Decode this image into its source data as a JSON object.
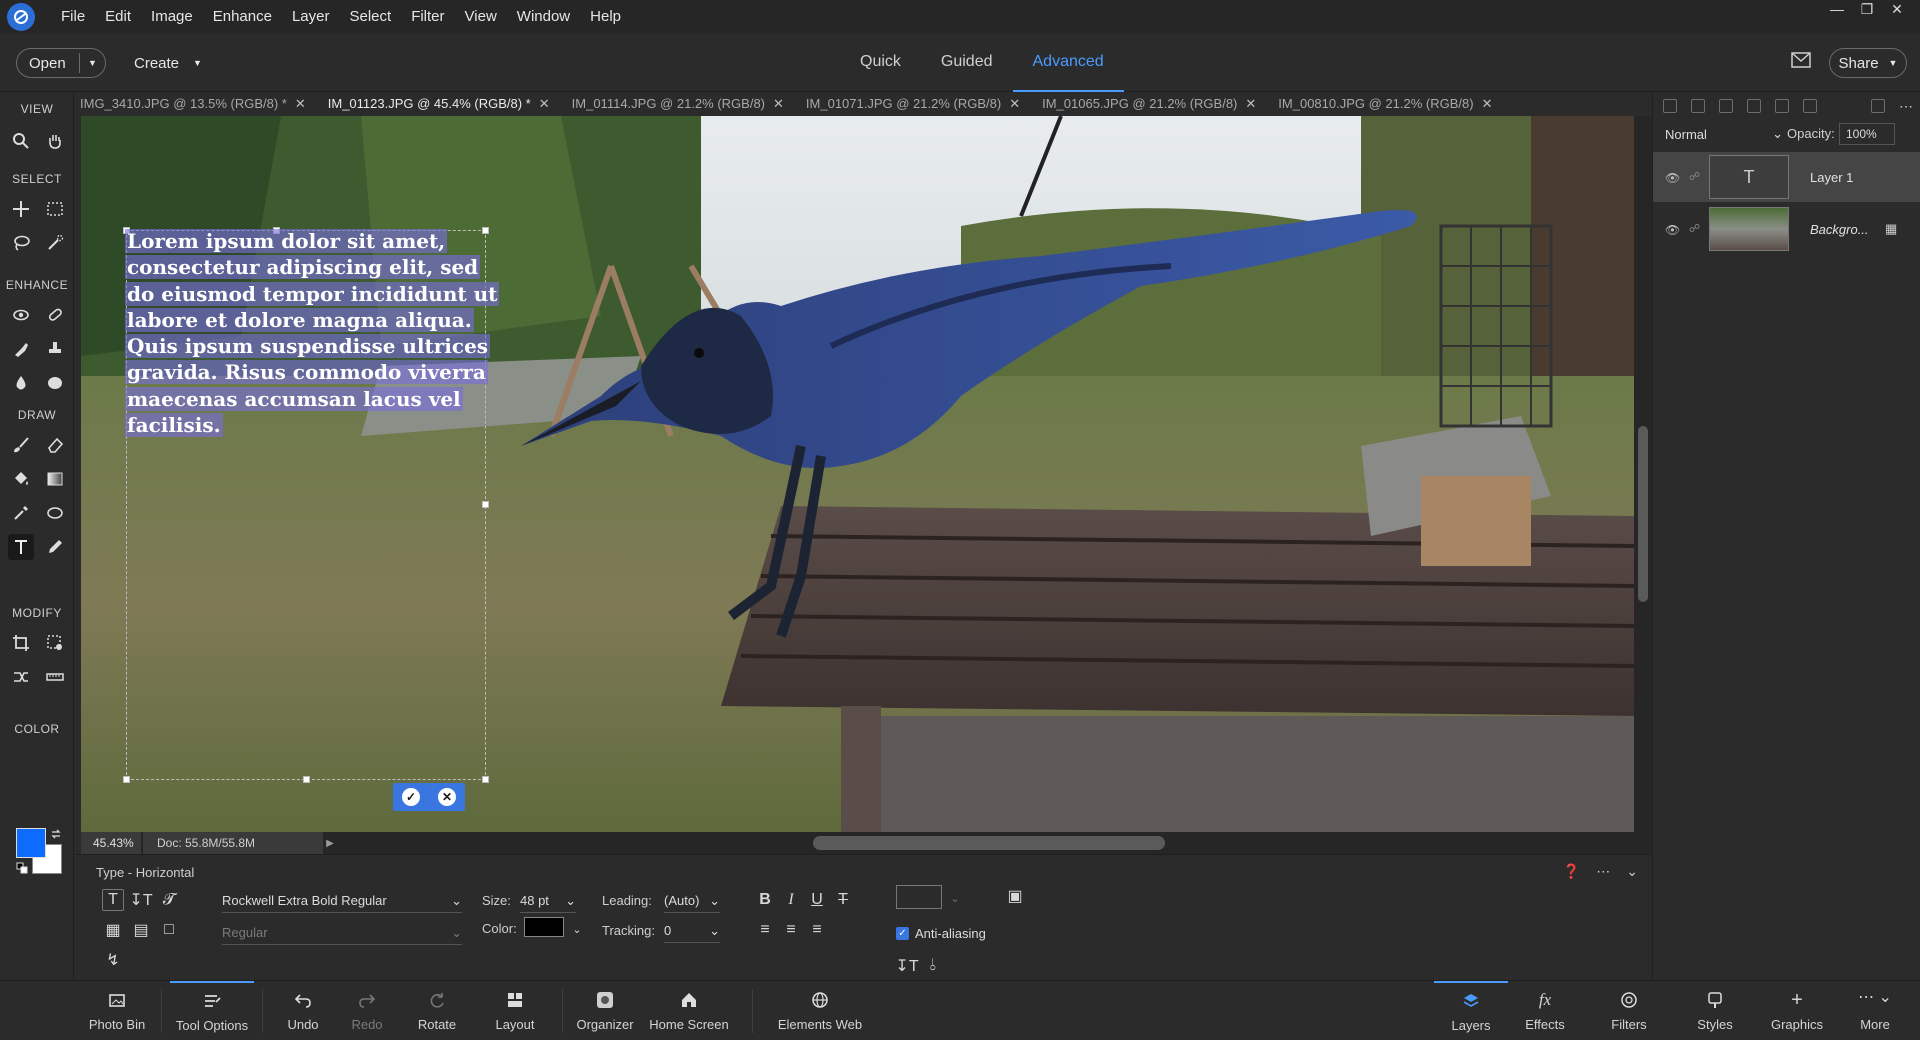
{
  "menubar": {
    "items": [
      "File",
      "Edit",
      "Image",
      "Enhance",
      "Layer",
      "Select",
      "Filter",
      "View",
      "Window",
      "Help"
    ],
    "window_controls": [
      "minimize-icon",
      "restore-icon",
      "close-icon"
    ]
  },
  "modebar": {
    "open_label": "Open",
    "create_label": "Create",
    "tabs": [
      "Quick",
      "Guided",
      "Advanced"
    ],
    "active_tab": "Advanced",
    "share_label": "Share"
  },
  "toolbox": {
    "sections": {
      "view": "VIEW",
      "select": "SELECT",
      "enhance": "ENHANCE",
      "draw": "DRAW",
      "modify": "MODIFY",
      "color": "COLOR"
    },
    "foreground_color": "#0b6cff",
    "background_color": "#ffffff"
  },
  "doc_tabs": [
    {
      "label": "IMG_3410.JPG @ 13.5% (RGB/8) *",
      "active": false
    },
    {
      "label": "IM_01123.JPG @ 45.4% (RGB/8) *",
      "active": true
    },
    {
      "label": "IM_01114.JPG @ 21.2% (RGB/8)",
      "active": false
    },
    {
      "label": "IM_01071.JPG @ 21.2% (RGB/8)",
      "active": false
    },
    {
      "label": "IM_01065.JPG @ 21.2% (RGB/8)",
      "active": false
    },
    {
      "label": "IM_00810.JPG @ 21.2% (RGB/8)",
      "active": false
    }
  ],
  "canvas": {
    "overlay_text": "Lorem ipsum dolor sit amet, consectetur adipiscing elit, sed do eiusmod tempor incididunt ut labore et dolore magna aliqua. Quis ipsum suspendisse ultrices gravida. Risus commodo viverra maecenas accumsan lacus vel facilisis."
  },
  "status": {
    "zoom": "45.43%",
    "doc_size": "Doc: 55.8M/55.8M"
  },
  "tool_options": {
    "title": "Type - Horizontal",
    "font_family": "Rockwell Extra Bold Regular",
    "font_style": "Regular",
    "size_label": "Size:",
    "size_value": "48 pt",
    "leading_label": "Leading:",
    "leading_value": "(Auto)",
    "color_label": "Color:",
    "color_value": "#000000",
    "tracking_label": "Tracking:",
    "tracking_value": "0",
    "anti_aliasing_label": "Anti-aliasing",
    "anti_aliasing_checked": true
  },
  "bottombar": {
    "left": [
      "Photo Bin",
      "Tool Options",
      "Undo",
      "Redo",
      "Rotate",
      "Layout",
      "Organizer",
      "Home Screen",
      "Elements Web"
    ],
    "right": [
      "Layers",
      "Effects",
      "Filters",
      "Styles",
      "Graphics",
      "More"
    ],
    "active_left": "Tool Options",
    "active_right": "Layers"
  },
  "layers_panel": {
    "blend_mode": "Normal",
    "opacity_label": "Opacity:",
    "opacity_value": "100%",
    "layers": [
      {
        "name": "Layer 1",
        "type": "text",
        "selected": true
      },
      {
        "name": "Backgro...",
        "type": "image",
        "selected": false
      }
    ]
  }
}
